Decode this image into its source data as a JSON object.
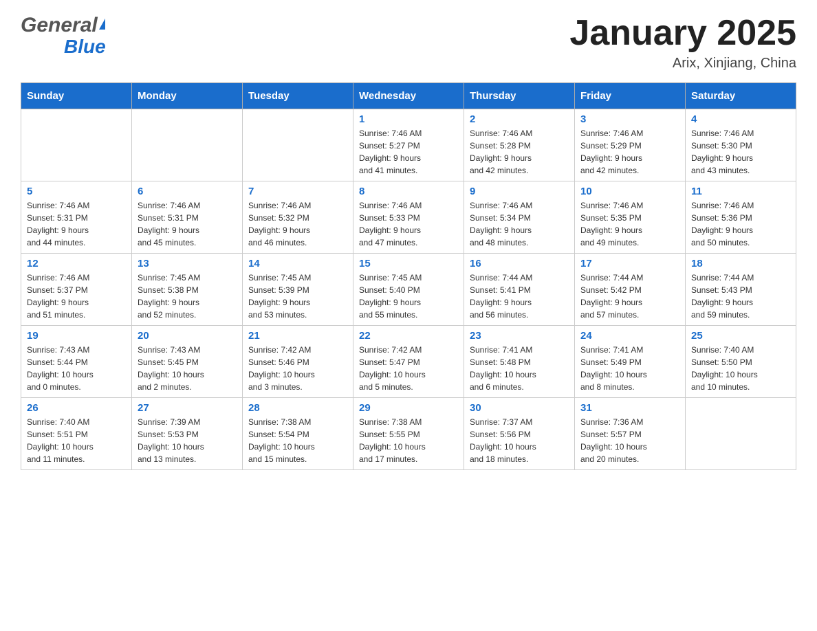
{
  "header": {
    "logo_general": "General",
    "logo_blue": "Blue",
    "month_year": "January 2025",
    "location": "Arix, Xinjiang, China"
  },
  "days_of_week": [
    "Sunday",
    "Monday",
    "Tuesday",
    "Wednesday",
    "Thursday",
    "Friday",
    "Saturday"
  ],
  "weeks": [
    [
      {
        "day": "",
        "info": ""
      },
      {
        "day": "",
        "info": ""
      },
      {
        "day": "",
        "info": ""
      },
      {
        "day": "1",
        "info": "Sunrise: 7:46 AM\nSunset: 5:27 PM\nDaylight: 9 hours\nand 41 minutes."
      },
      {
        "day": "2",
        "info": "Sunrise: 7:46 AM\nSunset: 5:28 PM\nDaylight: 9 hours\nand 42 minutes."
      },
      {
        "day": "3",
        "info": "Sunrise: 7:46 AM\nSunset: 5:29 PM\nDaylight: 9 hours\nand 42 minutes."
      },
      {
        "day": "4",
        "info": "Sunrise: 7:46 AM\nSunset: 5:30 PM\nDaylight: 9 hours\nand 43 minutes."
      }
    ],
    [
      {
        "day": "5",
        "info": "Sunrise: 7:46 AM\nSunset: 5:31 PM\nDaylight: 9 hours\nand 44 minutes."
      },
      {
        "day": "6",
        "info": "Sunrise: 7:46 AM\nSunset: 5:31 PM\nDaylight: 9 hours\nand 45 minutes."
      },
      {
        "day": "7",
        "info": "Sunrise: 7:46 AM\nSunset: 5:32 PM\nDaylight: 9 hours\nand 46 minutes."
      },
      {
        "day": "8",
        "info": "Sunrise: 7:46 AM\nSunset: 5:33 PM\nDaylight: 9 hours\nand 47 minutes."
      },
      {
        "day": "9",
        "info": "Sunrise: 7:46 AM\nSunset: 5:34 PM\nDaylight: 9 hours\nand 48 minutes."
      },
      {
        "day": "10",
        "info": "Sunrise: 7:46 AM\nSunset: 5:35 PM\nDaylight: 9 hours\nand 49 minutes."
      },
      {
        "day": "11",
        "info": "Sunrise: 7:46 AM\nSunset: 5:36 PM\nDaylight: 9 hours\nand 50 minutes."
      }
    ],
    [
      {
        "day": "12",
        "info": "Sunrise: 7:46 AM\nSunset: 5:37 PM\nDaylight: 9 hours\nand 51 minutes."
      },
      {
        "day": "13",
        "info": "Sunrise: 7:45 AM\nSunset: 5:38 PM\nDaylight: 9 hours\nand 52 minutes."
      },
      {
        "day": "14",
        "info": "Sunrise: 7:45 AM\nSunset: 5:39 PM\nDaylight: 9 hours\nand 53 minutes."
      },
      {
        "day": "15",
        "info": "Sunrise: 7:45 AM\nSunset: 5:40 PM\nDaylight: 9 hours\nand 55 minutes."
      },
      {
        "day": "16",
        "info": "Sunrise: 7:44 AM\nSunset: 5:41 PM\nDaylight: 9 hours\nand 56 minutes."
      },
      {
        "day": "17",
        "info": "Sunrise: 7:44 AM\nSunset: 5:42 PM\nDaylight: 9 hours\nand 57 minutes."
      },
      {
        "day": "18",
        "info": "Sunrise: 7:44 AM\nSunset: 5:43 PM\nDaylight: 9 hours\nand 59 minutes."
      }
    ],
    [
      {
        "day": "19",
        "info": "Sunrise: 7:43 AM\nSunset: 5:44 PM\nDaylight: 10 hours\nand 0 minutes."
      },
      {
        "day": "20",
        "info": "Sunrise: 7:43 AM\nSunset: 5:45 PM\nDaylight: 10 hours\nand 2 minutes."
      },
      {
        "day": "21",
        "info": "Sunrise: 7:42 AM\nSunset: 5:46 PM\nDaylight: 10 hours\nand 3 minutes."
      },
      {
        "day": "22",
        "info": "Sunrise: 7:42 AM\nSunset: 5:47 PM\nDaylight: 10 hours\nand 5 minutes."
      },
      {
        "day": "23",
        "info": "Sunrise: 7:41 AM\nSunset: 5:48 PM\nDaylight: 10 hours\nand 6 minutes."
      },
      {
        "day": "24",
        "info": "Sunrise: 7:41 AM\nSunset: 5:49 PM\nDaylight: 10 hours\nand 8 minutes."
      },
      {
        "day": "25",
        "info": "Sunrise: 7:40 AM\nSunset: 5:50 PM\nDaylight: 10 hours\nand 10 minutes."
      }
    ],
    [
      {
        "day": "26",
        "info": "Sunrise: 7:40 AM\nSunset: 5:51 PM\nDaylight: 10 hours\nand 11 minutes."
      },
      {
        "day": "27",
        "info": "Sunrise: 7:39 AM\nSunset: 5:53 PM\nDaylight: 10 hours\nand 13 minutes."
      },
      {
        "day": "28",
        "info": "Sunrise: 7:38 AM\nSunset: 5:54 PM\nDaylight: 10 hours\nand 15 minutes."
      },
      {
        "day": "29",
        "info": "Sunrise: 7:38 AM\nSunset: 5:55 PM\nDaylight: 10 hours\nand 17 minutes."
      },
      {
        "day": "30",
        "info": "Sunrise: 7:37 AM\nSunset: 5:56 PM\nDaylight: 10 hours\nand 18 minutes."
      },
      {
        "day": "31",
        "info": "Sunrise: 7:36 AM\nSunset: 5:57 PM\nDaylight: 10 hours\nand 20 minutes."
      },
      {
        "day": "",
        "info": ""
      }
    ]
  ]
}
